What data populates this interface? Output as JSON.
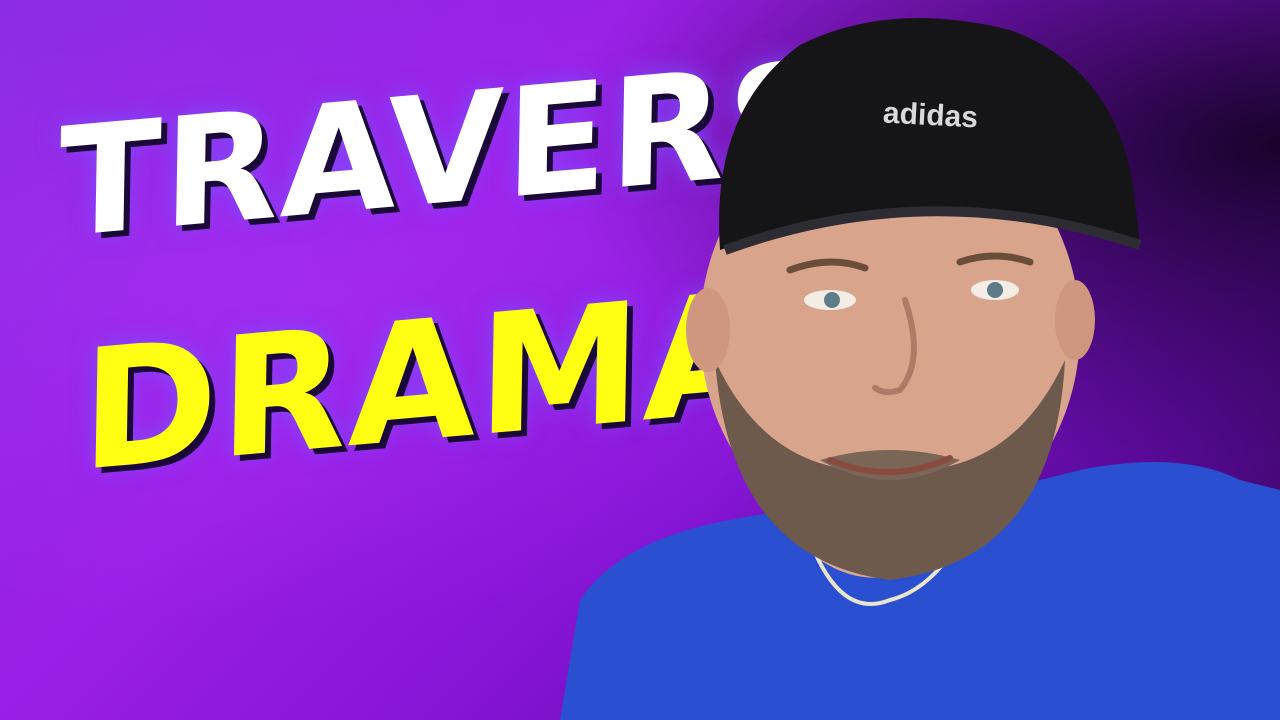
{
  "thumbnail": {
    "headline_line_1": "TRAVERSY",
    "headline_line_2": "DRAMA",
    "cap_logo": "adidas"
  },
  "colors": {
    "background": "#9b1fe8",
    "headline_line_1": "#ffffff",
    "headline_line_2": "#ffff14",
    "shirt": "#2a4fd0",
    "cap": "#151518"
  }
}
